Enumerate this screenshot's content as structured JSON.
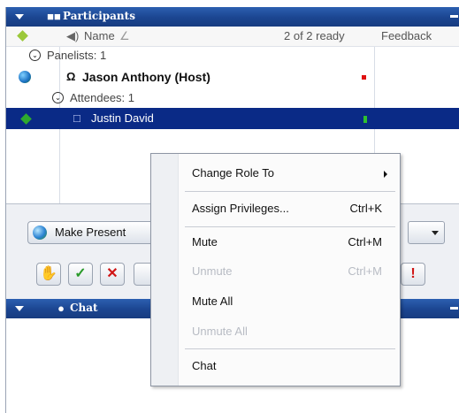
{
  "participants": {
    "title": "Participants",
    "columns": {
      "name": "Name",
      "ready": "2 of 2 ready",
      "feedback": "Feedback"
    },
    "panelists_label": "Panelists: 1",
    "host_name": "Jason Anthony (Host)",
    "attendees_label": "Attendees: 1",
    "attendee_name": "Justin David"
  },
  "toolbar": {
    "make_presenter_label": "Make Present"
  },
  "chat": {
    "title": "Chat"
  },
  "context_menu": {
    "change_role": "Change Role To",
    "assign_privileges": "Assign Privileges...",
    "assign_privileges_shortcut": "Ctrl+K",
    "mute": "Mute",
    "mute_shortcut": "Ctrl+M",
    "unmute": "Unmute",
    "unmute_shortcut": "Ctrl+M",
    "mute_all": "Mute All",
    "unmute_all": "Unmute All",
    "chat": "Chat"
  },
  "colors": {
    "titlebar": "#1b4590",
    "selection": "#0a2a86"
  }
}
